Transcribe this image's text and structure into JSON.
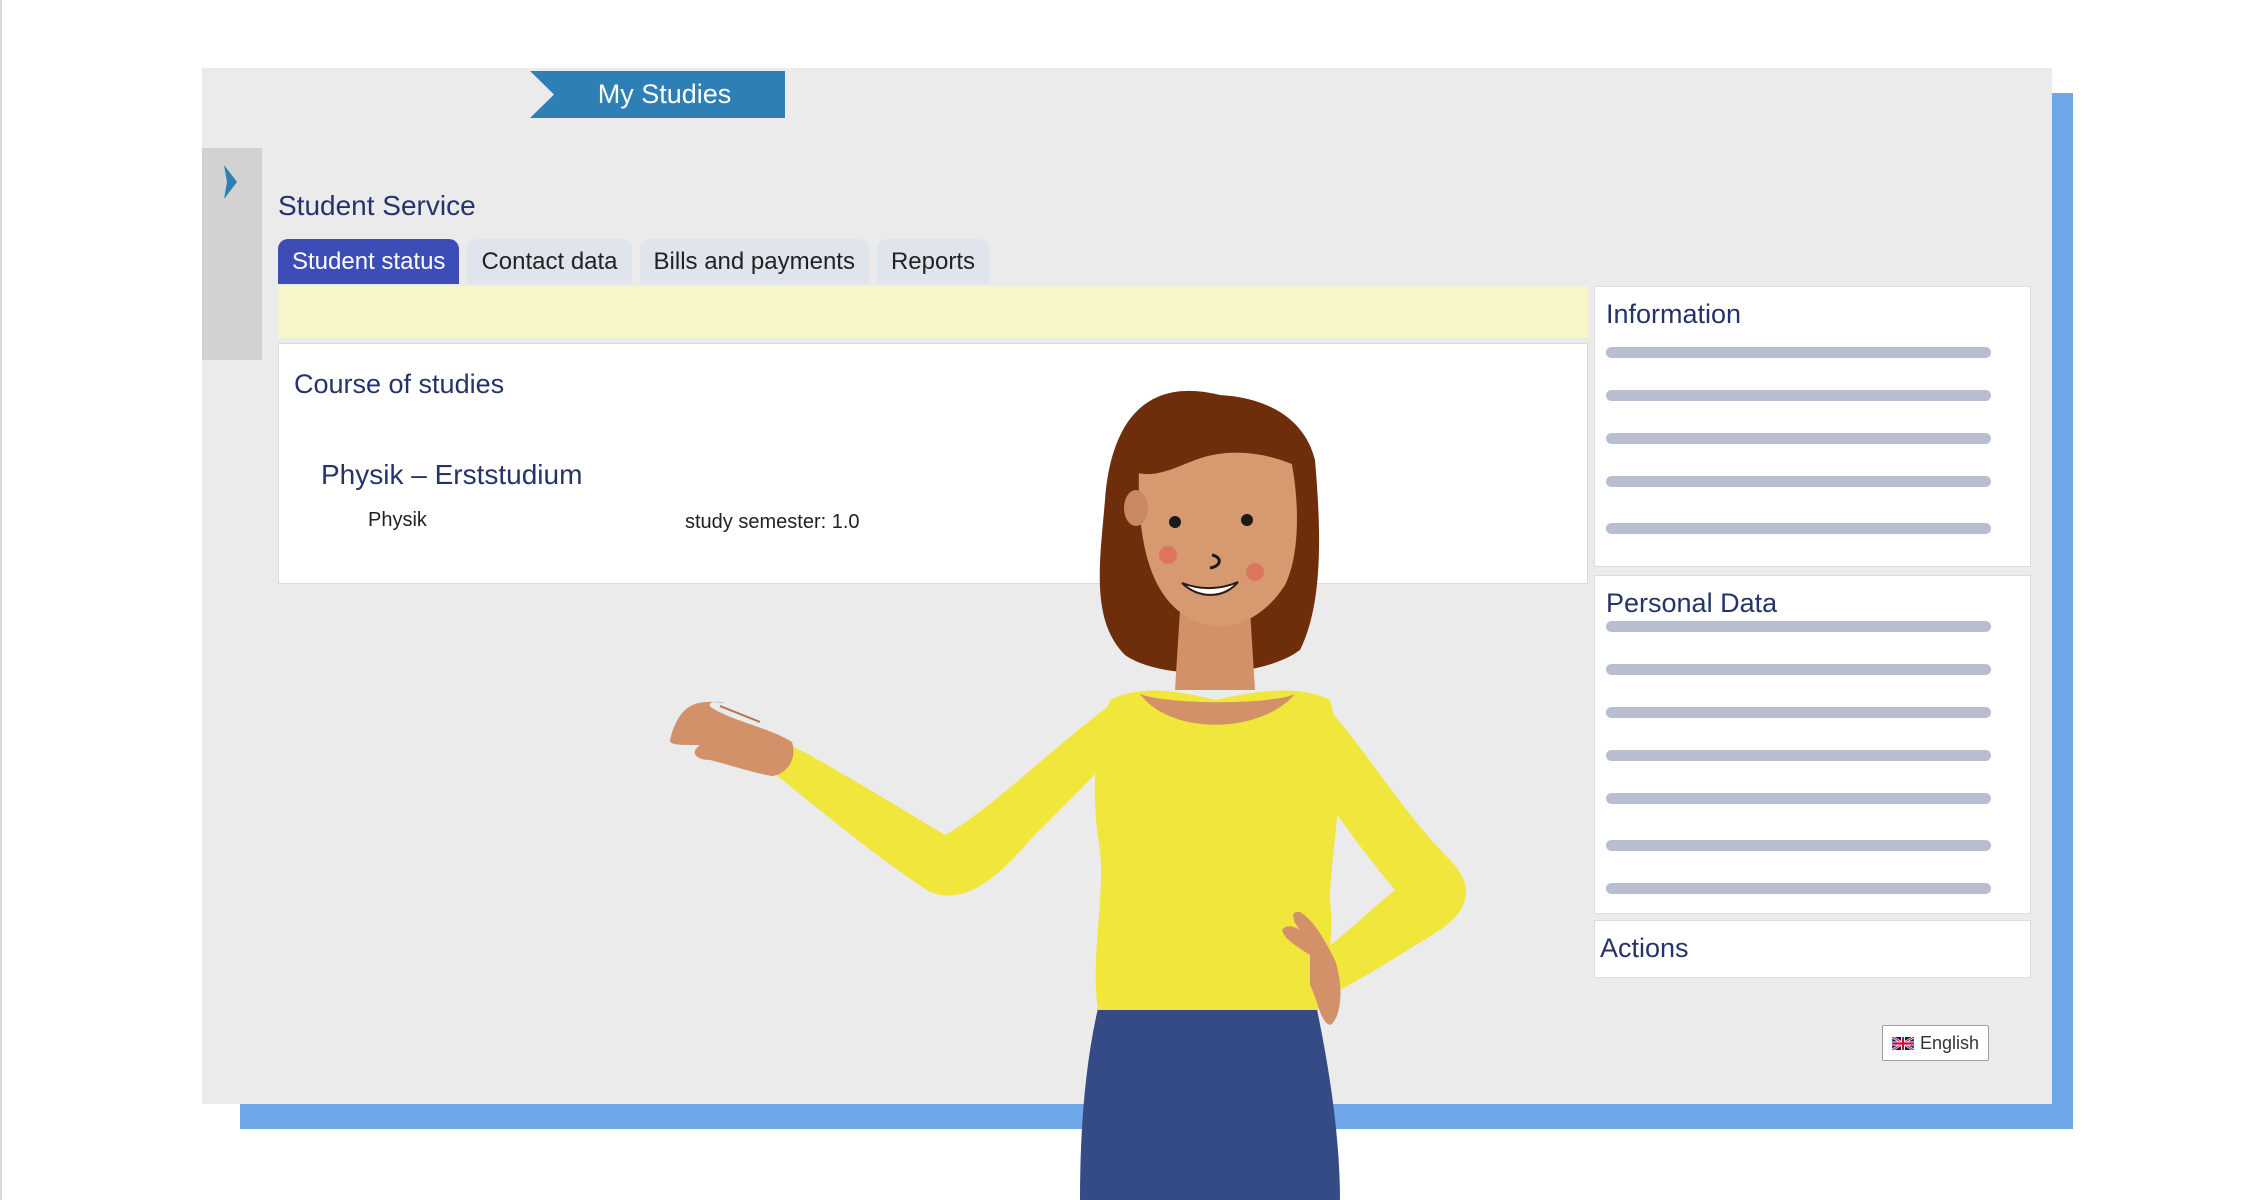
{
  "header": {
    "ribbon_label": "My Studies"
  },
  "service": {
    "title": "Student Service",
    "tabs": [
      {
        "label": "Student status",
        "active": true
      },
      {
        "label": "Contact data",
        "active": false
      },
      {
        "label": "Bills and payments",
        "active": false
      },
      {
        "label": "Reports",
        "active": false
      }
    ]
  },
  "course": {
    "heading": "Course of studies",
    "name": "Physik – Erststudium",
    "subject": "Physik",
    "semester": "study semester: 1.0"
  },
  "side": {
    "information_title": "Information",
    "personal_title": "Personal Data",
    "actions_title": "Actions"
  },
  "language": {
    "label": "English",
    "flag_icon": "uk-flag-icon"
  },
  "colors": {
    "accent_blue": "#2e7fb5",
    "active_tab": "#3d4db7",
    "shadow_blue": "#6ea8e8",
    "notice_yellow": "#f6f6c9",
    "shirt_yellow": "#f0e63c",
    "pants_navy": "#354b86"
  }
}
